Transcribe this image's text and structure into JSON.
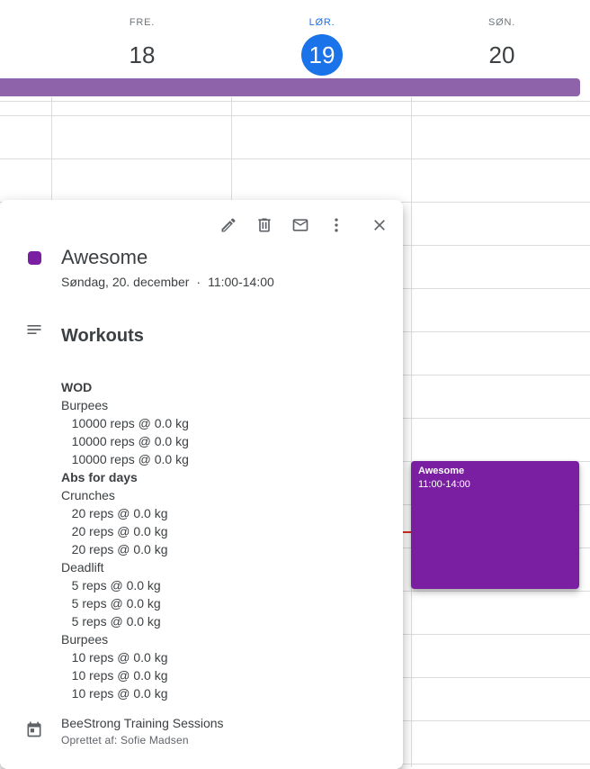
{
  "days": [
    {
      "name": "FRE.",
      "number": "18",
      "today": false
    },
    {
      "name": "LØR.",
      "number": "19",
      "today": true
    },
    {
      "name": "SØN.",
      "number": "20",
      "today": false
    }
  ],
  "event_block": {
    "title": "Awesome",
    "time": "11:00-14:00",
    "color": "#7b1fa2"
  },
  "popup": {
    "toolbar": [
      {
        "name": "edit-icon",
        "label": "Edit"
      },
      {
        "name": "delete-icon",
        "label": "Delete"
      },
      {
        "name": "email-icon",
        "label": "Email"
      },
      {
        "name": "more-options-icon",
        "label": "More options"
      },
      {
        "name": "close-icon",
        "label": "Close"
      }
    ],
    "title": "Awesome",
    "date": "Søndag, 20. december",
    "separator": "·",
    "time": "11:00-14:00",
    "description_heading": "Workouts",
    "description_lines": [
      {
        "text": "WOD",
        "bold": true
      },
      {
        "text": "Burpees",
        "bold": false
      },
      {
        "text": "   10000 reps @ 0.0 kg",
        "bold": false
      },
      {
        "text": "   10000 reps @ 0.0 kg",
        "bold": false
      },
      {
        "text": "   10000 reps @ 0.0 kg",
        "bold": false
      },
      {
        "text": "Abs for days",
        "bold": true
      },
      {
        "text": "Crunches",
        "bold": false
      },
      {
        "text": "   20 reps @ 0.0 kg",
        "bold": false
      },
      {
        "text": "   20 reps @ 0.0 kg",
        "bold": false
      },
      {
        "text": "   20 reps @ 0.0 kg",
        "bold": false
      },
      {
        "text": "Deadlift",
        "bold": false
      },
      {
        "text": "   5 reps @ 0.0 kg",
        "bold": false
      },
      {
        "text": "   5 reps @ 0.0 kg",
        "bold": false
      },
      {
        "text": "   5 reps @ 0.0 kg",
        "bold": false
      },
      {
        "text": "Burpees",
        "bold": false
      },
      {
        "text": "   10 reps @ 0.0 kg",
        "bold": false
      },
      {
        "text": "   10 reps @ 0.0 kg",
        "bold": false
      },
      {
        "text": "   10 reps @ 0.0 kg",
        "bold": false
      }
    ],
    "calendar_name": "BeeStrong Training Sessions",
    "created_by": "Oprettet af: Sofie Madsen"
  },
  "colors": {
    "accent": "#1a73e8",
    "event": "#7b1fa2",
    "allday_bar": "#8e63a9",
    "now_line": "#d93025"
  }
}
